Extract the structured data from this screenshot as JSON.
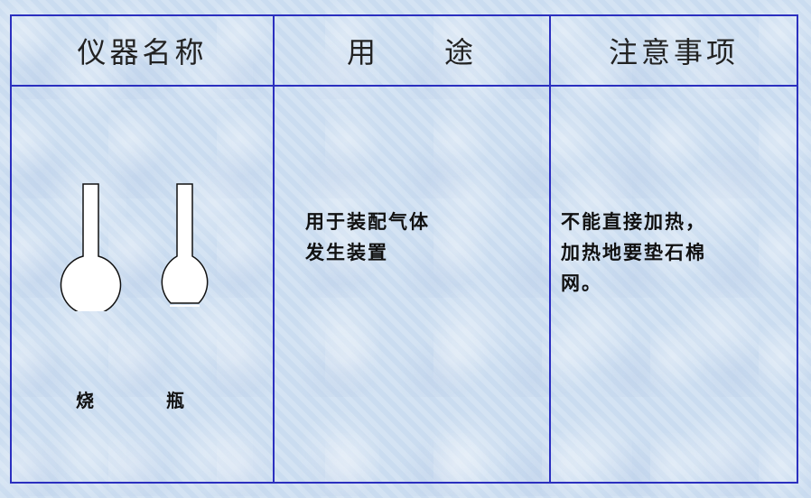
{
  "table": {
    "headers": [
      "仪器名称",
      "用　　途",
      "注意事项"
    ],
    "instrument": {
      "flask_label_1": "烧",
      "flask_label_2": "瓶"
    },
    "use": [
      "用于装配气体",
      "发生装置"
    ],
    "notes": [
      "不能直接加热，",
      "加热地要垫石棉",
      "网。"
    ]
  },
  "colors": {
    "border": "#2b2fbf",
    "background": "#cfe0f2"
  }
}
